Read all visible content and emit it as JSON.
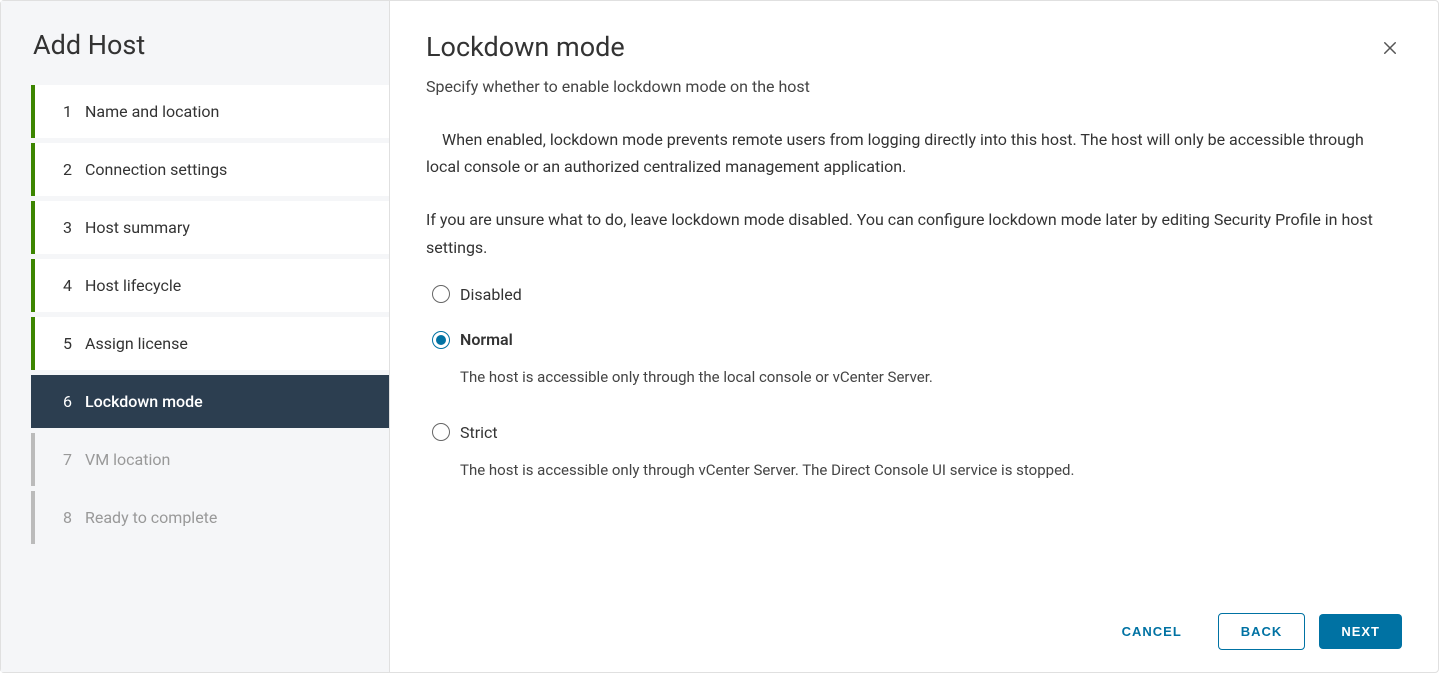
{
  "wizard": {
    "title": "Add Host",
    "steps": [
      {
        "number": "1",
        "label": "Name and location",
        "state": "completed"
      },
      {
        "number": "2",
        "label": "Connection settings",
        "state": "completed"
      },
      {
        "number": "3",
        "label": "Host summary",
        "state": "completed"
      },
      {
        "number": "4",
        "label": "Host lifecycle",
        "state": "completed"
      },
      {
        "number": "5",
        "label": "Assign license",
        "state": "completed"
      },
      {
        "number": "6",
        "label": "Lockdown mode",
        "state": "active"
      },
      {
        "number": "7",
        "label": "VM location",
        "state": "upcoming"
      },
      {
        "number": "8",
        "label": "Ready to complete",
        "state": "upcoming"
      }
    ]
  },
  "content": {
    "title": "Lockdown mode",
    "subtitle": "Specify whether to enable lockdown mode on the host",
    "intro": "When enabled, lockdown mode prevents remote users from logging directly into this host. The host will only be accessible through local console or an authorized centralized management application.",
    "hint": "If you are unsure what to do, leave lockdown mode disabled. You can configure lockdown mode later by editing Security Profile in host settings.",
    "options": {
      "disabled": {
        "label": "Disabled"
      },
      "normal": {
        "label": "Normal",
        "description": "The host is accessible only through the local console or vCenter Server."
      },
      "strict": {
        "label": "Strict",
        "description": "The host is accessible only through vCenter Server. The Direct Console UI service is stopped."
      },
      "selected": "normal"
    }
  },
  "footer": {
    "cancel": "CANCEL",
    "back": "BACK",
    "next": "NEXT"
  }
}
